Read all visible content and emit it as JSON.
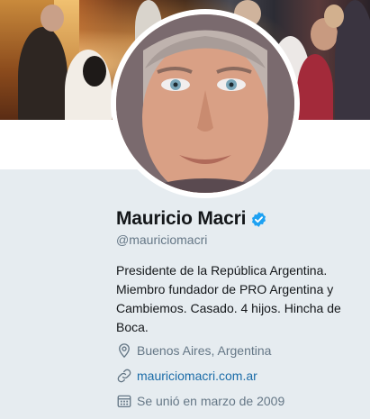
{
  "profile": {
    "name": "Mauricio Macri",
    "handle": "@mauriciomacri",
    "bio": "Presidente de la República Argentina. Miembro fundador de PRO Argentina y Cambiemos. Casado. 4 hijos. Hincha de Boca.",
    "location": "Buenos Aires, Argentina",
    "website": "mauriciomacri.com.ar",
    "joined": "Se unió en marzo de 2009"
  },
  "icons": {
    "verified": "verified-badge-icon",
    "location": "location-pin-icon",
    "website": "link-icon",
    "joined": "calendar-icon"
  },
  "colors": {
    "background": "#e6ecf0",
    "accent": "#1da1f2",
    "link": "#1b6ca8",
    "secondary_text": "#657786"
  }
}
